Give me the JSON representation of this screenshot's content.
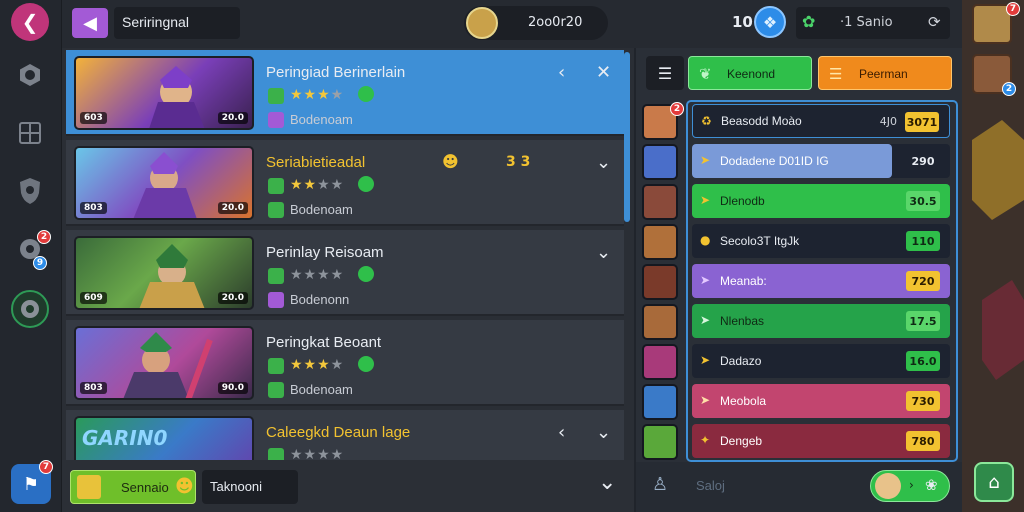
{
  "colors": {
    "accent_blue": "#3e8fd6",
    "green": "#2fbf4a",
    "orange": "#f08a1c",
    "purple": "#8a63d2",
    "pink": "#c2456f",
    "gold": "#f2c230"
  },
  "topbar": {
    "title": "Seriringnal",
    "center_value": "2oo0r20",
    "level_number": "10",
    "right_label": "·1 Sanio"
  },
  "list": {
    "rows": [
      {
        "name": "Peringiad Berinerlain",
        "level": "603",
        "power": "20.0",
        "stars": 3,
        "sub": "Bodenoam",
        "selected": true
      },
      {
        "name": "Seriabietieadal",
        "level": "803",
        "power": "20.0",
        "stars": 2,
        "sub": "Bodenoam",
        "extra": "3 3",
        "selected": false
      },
      {
        "name": "Perinlay Reisoam",
        "level": "609",
        "power": "20.0",
        "stars": 0,
        "sub": "Bodenonn",
        "selected": false
      },
      {
        "name": "Peringkat Beoant",
        "level": "803",
        "power": "90.0",
        "stars": 3,
        "sub": "Bodenoam",
        "selected": false
      },
      {
        "name": "Caleegkd Deaun lage",
        "level": "",
        "power": "",
        "stars": 1,
        "sub": "",
        "banner": "GARIN0",
        "selected": false
      }
    ]
  },
  "bottombar": {
    "green_button": "Sennaio",
    "dark_button": "Taknooni"
  },
  "right": {
    "btn_green": "Keenond",
    "btn_orange": "Peerman",
    "stats": [
      {
        "label": "Beasodd Moào",
        "value": "3071",
        "aux": "4J0"
      },
      {
        "label": "Dodadene D01ID IG",
        "value": "290"
      },
      {
        "label": "Dlenodb",
        "value": "30.5"
      },
      {
        "label": "Secolo3T ItgJk",
        "value": "110"
      },
      {
        "label": "Meanab:",
        "value": "720"
      },
      {
        "label": "Nlenbas",
        "value": "17.5"
      },
      {
        "label": "Dadazo",
        "value": "16.0"
      },
      {
        "label": "Meobola",
        "value": "730"
      },
      {
        "label": "Dengeb",
        "value": "780"
      }
    ],
    "footer_label": "Saloj"
  }
}
